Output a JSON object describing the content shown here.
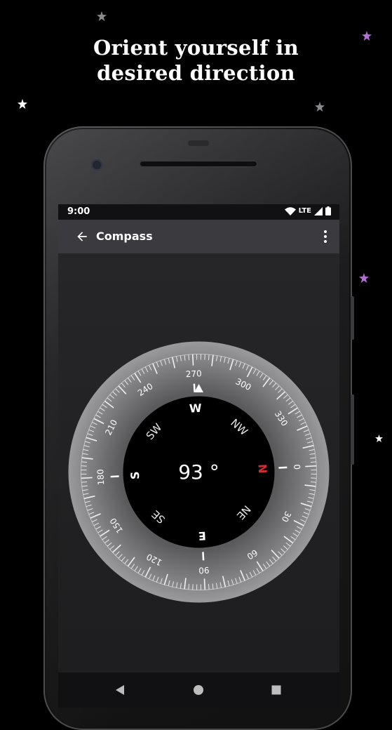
{
  "headline": {
    "line1": "Orient yourself in",
    "line2": "desired direction"
  },
  "status_bar": {
    "time": "9:00",
    "network": "LTE",
    "icons": [
      "wifi-icon",
      "signal-icon",
      "battery-icon"
    ]
  },
  "app_bar": {
    "title": "Compass",
    "back_icon": "arrow-left-icon",
    "menu_icon": "more-vert-icon"
  },
  "compass": {
    "heading_text": "93 °",
    "heading_degrees": 93,
    "cardinals": [
      "N",
      "E",
      "S",
      "W"
    ],
    "intercardinals": [
      "NE",
      "SE",
      "SW",
      "NW"
    ],
    "degree_labels": [
      "0",
      "30",
      "60",
      "90",
      "120",
      "150",
      "180",
      "210",
      "240",
      "270",
      "300",
      "330"
    ],
    "north_color": "#d32f2f"
  },
  "nav_bar": {
    "items": [
      "back-triangle-icon",
      "home-circle-icon",
      "recents-square-icon"
    ]
  },
  "colors": {
    "background": "#000000",
    "screen": "#1e1e20",
    "appbar": "#3b3b3f",
    "star_white": "#ffffff",
    "star_gray": "#8a8a8e",
    "star_purple": "#b46fd6"
  }
}
